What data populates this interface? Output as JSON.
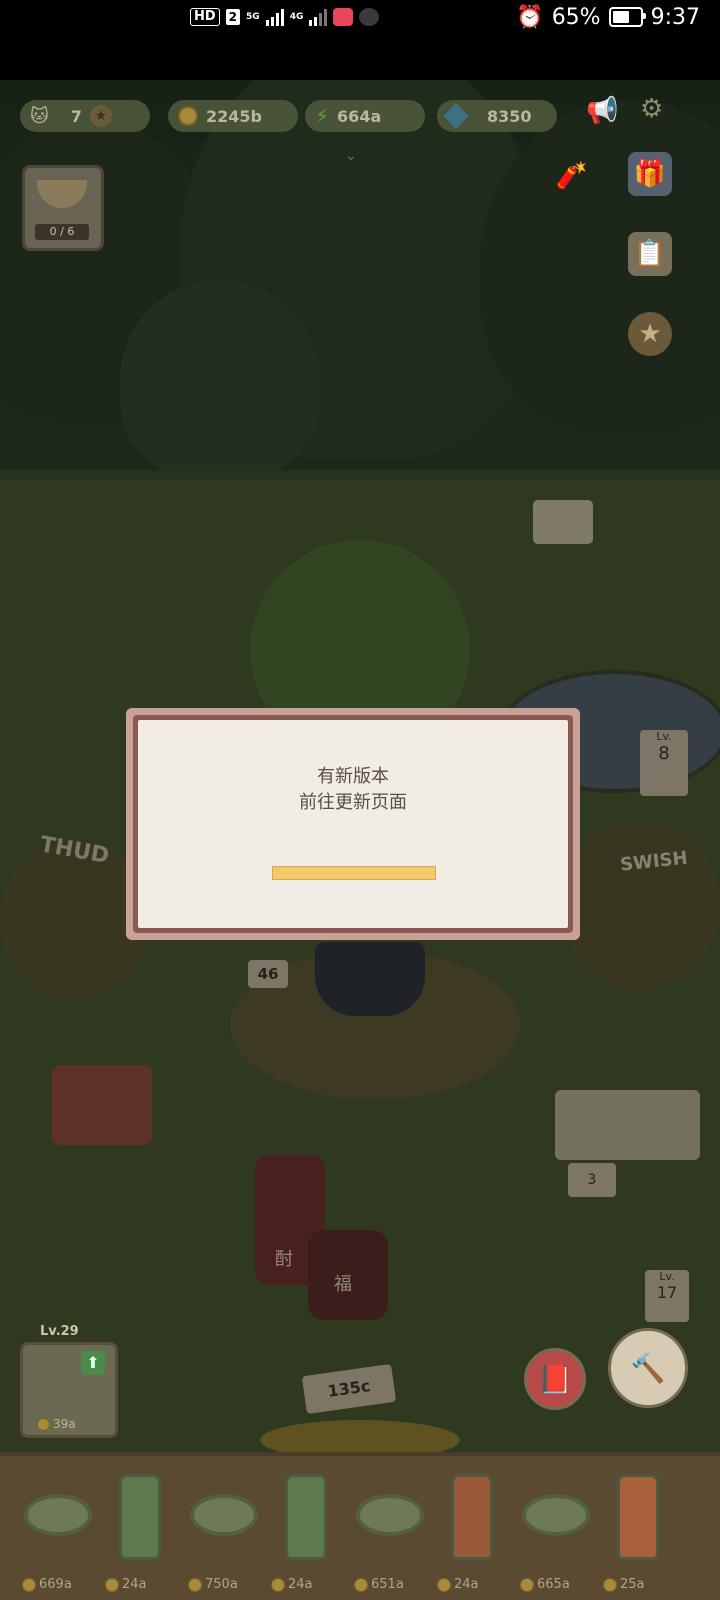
{
  "status_bar": {
    "hd": "HD",
    "sim": "2",
    "net_5g": "5G",
    "net_4g": "4G",
    "battery": "65%",
    "battery_level": 0.65,
    "time": "9:37"
  },
  "hud": {
    "cats": "7",
    "coins": "2245b",
    "energy": "664a",
    "gems": "8350"
  },
  "recipe_card": {
    "count": "0 / 6"
  },
  "world_labels": {
    "thud": "THUD",
    "swish": "SWISH",
    "sign_lv_right": "Lv.",
    "sign_lv_right_num": "8",
    "pot_sign": "46",
    "hammock_sign": "3",
    "sign_lv_bottom": "Lv.",
    "sign_lv_bottom_num": "17",
    "jar_left": "酎",
    "jar_mid": "福",
    "gold_sign": "135c"
  },
  "dialog": {
    "line1": "有新版本",
    "line2": "前往更新页面",
    "progress": 1.0
  },
  "build": {
    "level": "Lv.29",
    "price": "39a"
  },
  "tray": [
    {
      "kind": "bowl",
      "price": "669a"
    },
    {
      "kind": "jar",
      "price": "24a"
    },
    {
      "kind": "bowl",
      "price": "750a"
    },
    {
      "kind": "jar",
      "price": "24a"
    },
    {
      "kind": "bowl",
      "price": "651a"
    },
    {
      "kind": "jar",
      "price": "24a"
    },
    {
      "kind": "bowl",
      "price": "665a"
    },
    {
      "kind": "jar",
      "price": "25a"
    }
  ],
  "icons": {
    "cat": "cat-icon",
    "star": "star-icon",
    "coin": "coin-icon",
    "bolt": "bolt-icon",
    "gem": "gem-icon",
    "speaker": "speaker-icon",
    "gear": "gear-icon",
    "firework": "firework-icon",
    "gift": "gift-icon",
    "notepad": "notepad-icon",
    "medal": "medal-icon",
    "recipe_book": "recipe-book-icon",
    "hammer": "hammer-icon"
  }
}
